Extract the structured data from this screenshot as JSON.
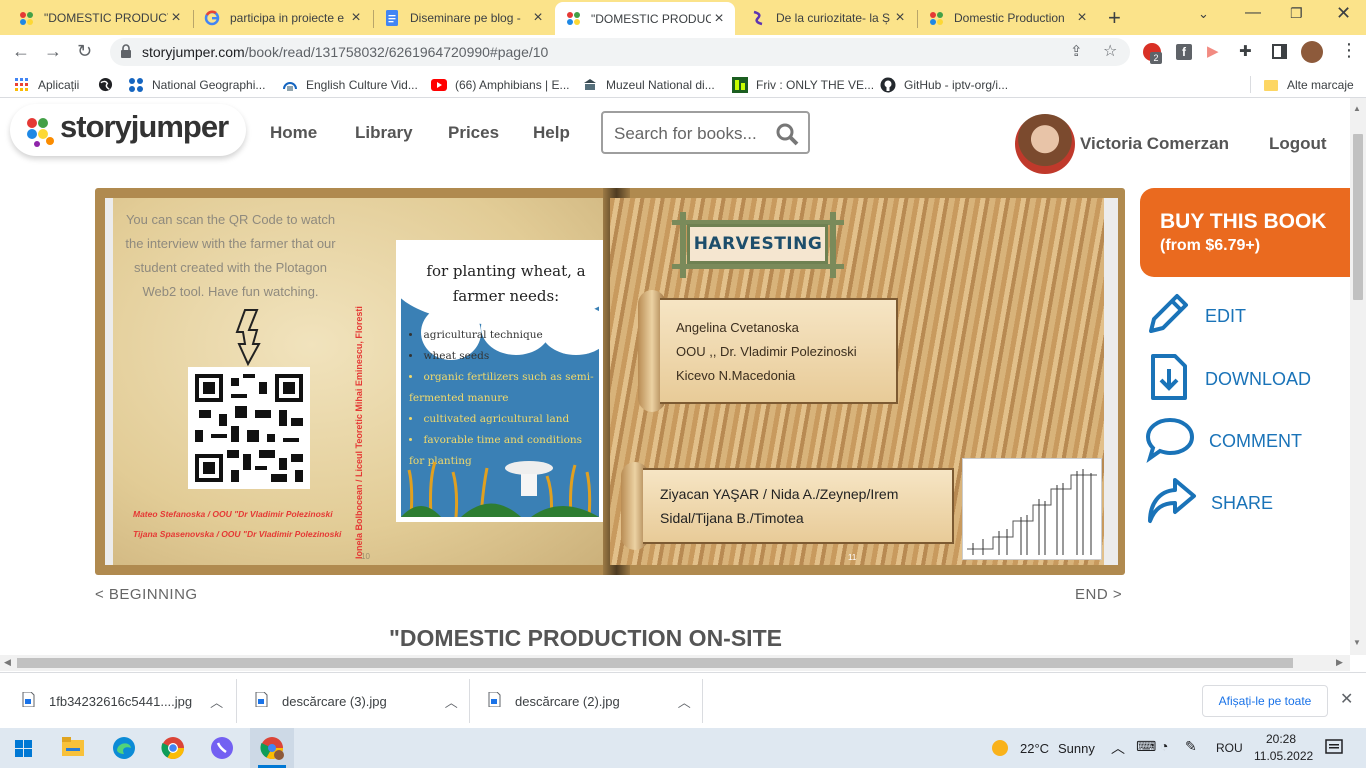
{
  "browser": {
    "tabs": [
      {
        "title": "\"DOMESTIC PRODUCT",
        "icon": "storyjumper-icon"
      },
      {
        "title": "participa in proiecte e",
        "icon": "google-icon"
      },
      {
        "title": "Diseminare pe blog - ",
        "icon": "docs-icon"
      },
      {
        "title": "\"DOMESTIC PRODUCT",
        "icon": "storyjumper-icon",
        "active": true
      },
      {
        "title": "De la curiozitate- la Ș",
        "icon": "site-icon"
      },
      {
        "title": "Domestic Production",
        "icon": "storyjumper-icon"
      }
    ],
    "url_domain": "storyjumper.com",
    "url_path": "/book/read/131758032/6261964720990#page/10",
    "extension_badge": "2",
    "bookmarks": [
      {
        "label": "Aplicații",
        "icon": "apps-grid-icon"
      },
      {
        "label": "",
        "icon": "globe-icon"
      },
      {
        "label": "National Geographi...",
        "icon": "ng-icon"
      },
      {
        "label": "English Culture Vid...",
        "icon": "ec-icon"
      },
      {
        "label": "(66) Amphibians | E...",
        "icon": "youtube-icon"
      },
      {
        "label": "Muzeul National di...",
        "icon": "museum-icon"
      },
      {
        "label": "Friv : ONLY THE VE...",
        "icon": "friv-icon"
      },
      {
        "label": "GitHub - iptv-org/i...",
        "icon": "github-icon"
      }
    ],
    "other_bookmarks": "Alte marcaje"
  },
  "site": {
    "logo": "storyjumper",
    "nav": [
      "Home",
      "Library",
      "Prices",
      "Help"
    ],
    "search_placeholder": "Search for books...",
    "user_name": "Victoria Comerzan",
    "logout": "Logout"
  },
  "book": {
    "left_page": {
      "intro": "You can scan the QR Code to watch the interview with the farmer that our student created with the Plotagon Web2 tool. Have fun watching.",
      "credit1": "Mateo Stefanoska  / OOU \"Dr Vladimir Polezinoski",
      "credit2": "Tijana Spasenovska  / OOU \"Dr Vladimir Polezinoski",
      "side_credit": "Ionela Bolbocean / Liceul Teoretic Mihai Eminescu, Floresti",
      "poster_title": "for planting wheat, a farmer needs:",
      "poster_items": [
        "agricultural technique",
        "wheat seeds",
        "organic fertilizers such as semi-fermented manure",
        "cultivated agricultural land",
        "favorable time and conditions for planting"
      ],
      "page_number": "10"
    },
    "right_page": {
      "title": "HARVESTING",
      "scroll1": [
        "Angelina Cvetanoska",
        "OOU ,, Dr. Vladimir Polezinoski",
        "Kicevo N.Macedonia"
      ],
      "scroll2": "Ziyacan YAŞAR / Nida A./Zeynep/Irem Sidal/Tijana B./Timotea",
      "page_number": "11"
    },
    "beginning": "< BEGINNING",
    "end": "END >",
    "heading": "\"DOMESTIC PRODUCTION ON-SITE"
  },
  "sidebar": {
    "buy_line1": "BUY THIS BOOK",
    "buy_line2": "(from $6.79+)",
    "actions": [
      {
        "label": "EDIT",
        "icon": "pencil-icon"
      },
      {
        "label": "DOWNLOAD",
        "icon": "download-icon"
      },
      {
        "label": "COMMENT",
        "icon": "comment-icon"
      },
      {
        "label": "SHARE",
        "icon": "share-icon"
      }
    ]
  },
  "downloads": {
    "items": [
      "1fb34232616c5441....jpg",
      "descărcare (3).jpg",
      "descărcare (2).jpg"
    ],
    "show_all": "Afișați-le pe toate"
  },
  "taskbar": {
    "temperature": "22°C",
    "weather": "Sunny",
    "language": "ROU",
    "time": "20:28",
    "date": "11.05.2022"
  },
  "colors": {
    "tab_strip": "#fbe38a",
    "accent_orange": "#ea6a1f",
    "action_blue": "#1a73b8",
    "book_frame": "#b08a4f"
  }
}
